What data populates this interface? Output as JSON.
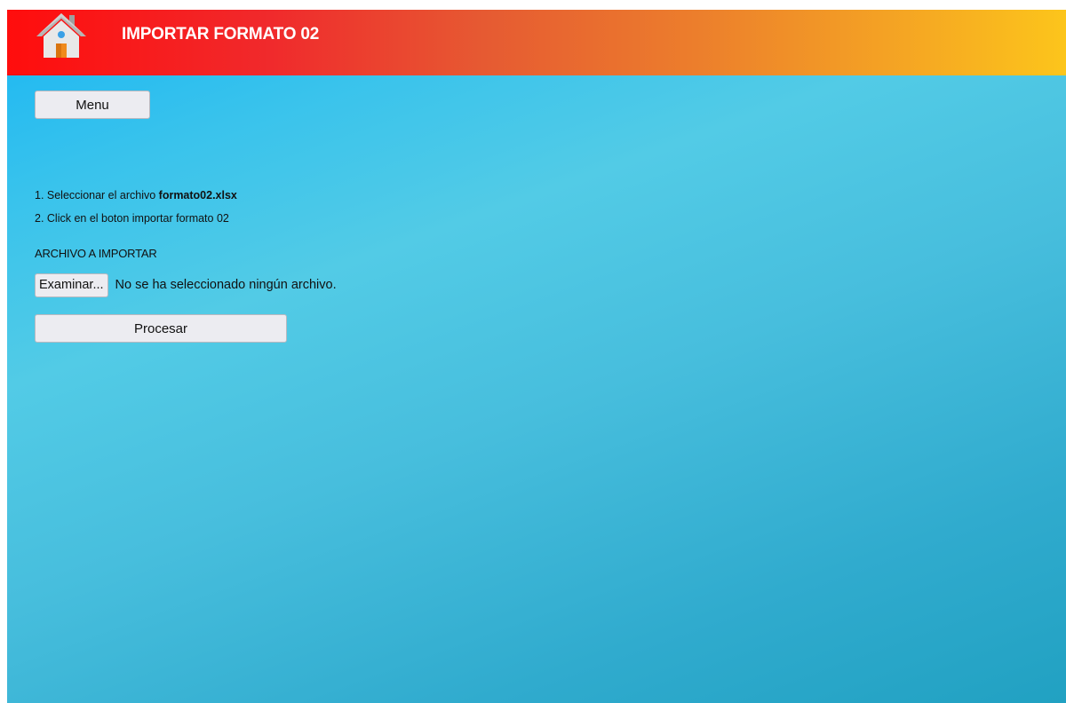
{
  "header": {
    "title": "IMPORTAR FORMATO 02",
    "icon": "home-icon",
    "gradient_start": "#ff0d0d",
    "gradient_end": "#fcc51b"
  },
  "menu": {
    "label": "Menu"
  },
  "instructions": {
    "step1_prefix": "1. Seleccionar el archivo ",
    "step1_file": "formato02.xlsx",
    "step2": "2. Click en el boton importar formato 02"
  },
  "upload": {
    "label": "ARCHIVO A IMPORTAR",
    "browse_label": "Examinar...",
    "status": "No se ha seleccionado ningún archivo."
  },
  "actions": {
    "process_label": "Procesar"
  },
  "colors": {
    "background_top": "#1ab6f3",
    "background_bottom": "#21a1c2",
    "button_bg": "#ececf1"
  }
}
